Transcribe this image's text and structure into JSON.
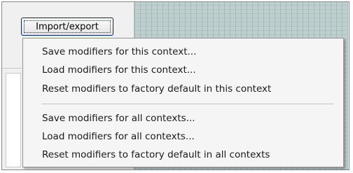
{
  "toolbar": {
    "import_export_label": "Import/export"
  },
  "menu": {
    "group1": [
      {
        "label": "Save modifiers for this context..."
      },
      {
        "label": "Load modifiers for this context..."
      },
      {
        "label": "Reset modifiers to factory default in this context"
      }
    ],
    "group2": [
      {
        "label": "Save modifiers for all contexts..."
      },
      {
        "label": "Load modifiers for all contexts..."
      },
      {
        "label": "Reset modifiers to factory default in all contexts"
      }
    ]
  },
  "colors": {
    "grid_background": "#bfcfcf",
    "menu_background": "#f5f5f5",
    "button_border": "#0a246a"
  }
}
